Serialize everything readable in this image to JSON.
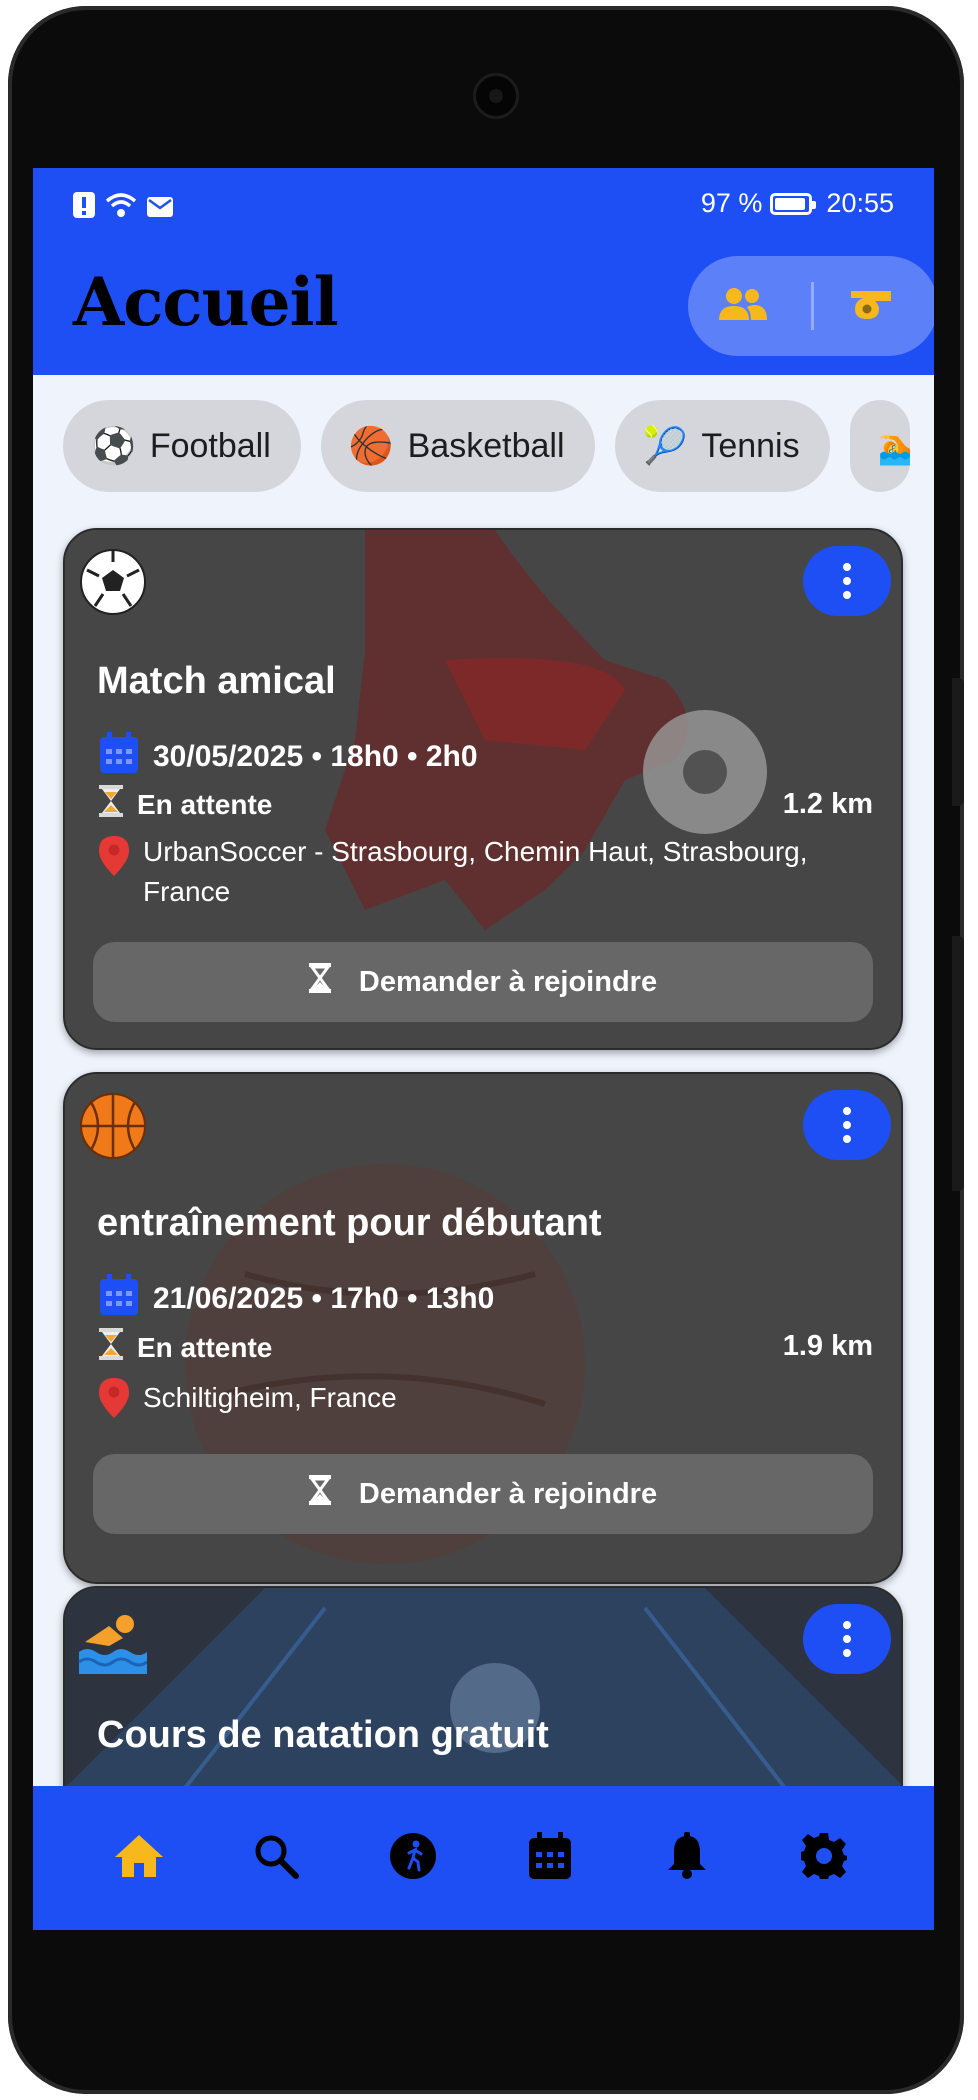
{
  "status_bar": {
    "battery_percent": "97 %",
    "time": "20:55"
  },
  "header": {
    "title": "Accueil",
    "actions": [
      {
        "icon": "group-icon"
      },
      {
        "icon": "whistle-icon"
      }
    ]
  },
  "categories": [
    {
      "label": "Football",
      "emoji": "⚽"
    },
    {
      "label": "Basketball",
      "emoji": "🏀"
    },
    {
      "label": "Tennis",
      "emoji": "🎾"
    },
    {
      "label": "",
      "emoji": "🏊"
    }
  ],
  "cards": [
    {
      "sport_icon": "soccer-ball-icon",
      "title": "Match amical",
      "datetime": "30/05/2025 • 18h0 • 2h0",
      "status": "En attente",
      "distance": "1.2 km",
      "location": "UrbanSoccer - Strasbourg, Chemin Haut, Strasbourg, France",
      "action": "Demander à rejoindre"
    },
    {
      "sport_icon": "basketball-icon",
      "title": "entraînement pour débutant",
      "datetime": "21/06/2025 • 17h0 • 13h0",
      "status": "En attente",
      "distance": "1.9 km",
      "location": "Schiltigheim, France",
      "action": "Demander à rejoindre"
    },
    {
      "sport_icon": "swimmer-icon",
      "title": "Cours de natation gratuit"
    }
  ],
  "bottom_nav": [
    {
      "icon": "home-icon",
      "active": true
    },
    {
      "icon": "search-icon",
      "active": false
    },
    {
      "icon": "activity-icon",
      "active": false
    },
    {
      "icon": "calendar-icon",
      "active": false
    },
    {
      "icon": "bell-icon",
      "active": false
    },
    {
      "icon": "settings-icon",
      "active": false
    }
  ],
  "colors": {
    "primary": "#1e4ff5",
    "active_nav": "#f6b81c",
    "card_bg": "#474747"
  }
}
